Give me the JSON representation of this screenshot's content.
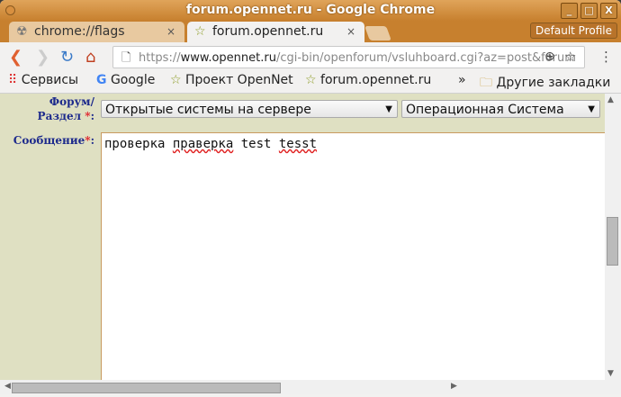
{
  "window": {
    "title": "forum.opennet.ru - Google Chrome",
    "buttons": [
      "_",
      "□",
      "X"
    ]
  },
  "tabs": [
    {
      "label": "chrome://flags",
      "icon": "radiation-icon",
      "close": "×"
    },
    {
      "label": "forum.opennet.ru",
      "icon": "star-icon",
      "close": "×"
    }
  ],
  "profile": "Default Profile",
  "address": {
    "scheme": "https://",
    "host": "www.opennet.ru",
    "path": "/cgi-bin/openforum/vsluhboard.cgi?az=post&forum"
  },
  "bookmarks": [
    {
      "label": "Сервисы",
      "icon": "apps-icon"
    },
    {
      "label": "Google",
      "icon": "google-icon"
    },
    {
      "label": "Проект OpenNet",
      "icon": "star-icon"
    },
    {
      "label": "forum.opennet.ru",
      "icon": "star-icon"
    }
  ],
  "bookmarks_more": "»",
  "other_bookmarks": "Другие закладки",
  "form": {
    "forum_label": "Форум/",
    "section_label": "Раздел ",
    "required": "*",
    "forum_select": "Открытые системы на сервере",
    "section_select": "Операционная Система",
    "message_label": "Сообщение",
    "message_words": [
      "проверка ",
      "праверка",
      " test ",
      "tesst"
    ]
  }
}
